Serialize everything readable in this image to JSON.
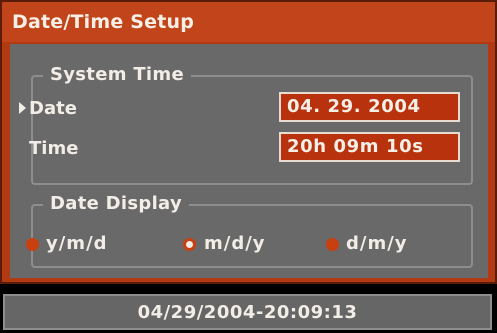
{
  "window": {
    "title": "Date/Time Setup"
  },
  "system_time": {
    "legend": "System Time",
    "date_label": "Date",
    "date_value": "04. 29. 2004",
    "time_label": "Time",
    "time_value": "20h 09m 10s"
  },
  "date_display": {
    "legend": "Date Display",
    "options": [
      {
        "label": "y/m/d",
        "selected": false
      },
      {
        "label": "m/d/y",
        "selected": true
      },
      {
        "label": "d/m/y",
        "selected": false
      }
    ]
  },
  "status": {
    "datetime": "04/29/2004-20:09:13"
  },
  "colors": {
    "title_bar": "#c1441a",
    "panel": "#696969",
    "value_box": "#b8320e",
    "radio": "#c8400f"
  }
}
